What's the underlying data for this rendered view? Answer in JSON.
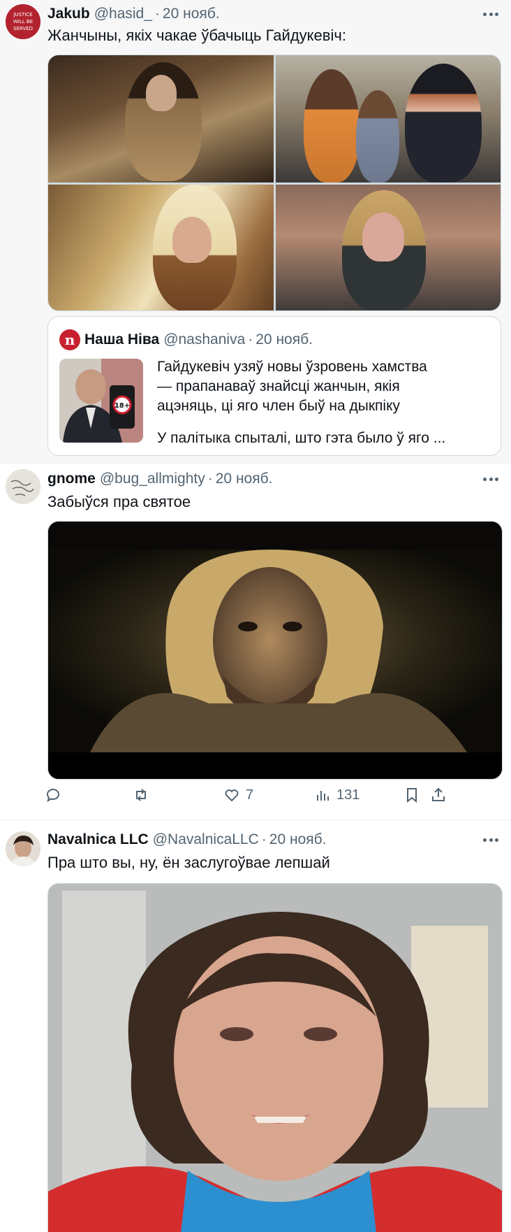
{
  "tweets": [
    {
      "name": "Jakub",
      "handle": "@hasid_",
      "dot": "·",
      "date": "20 нояб.",
      "text": "Жанчыны, якіх чакае ўбачыць Гайдукевіч:",
      "avatar_text": [
        "JUSTICE",
        "WILL BE",
        "SERVED"
      ],
      "quote": {
        "logo_letter": "n",
        "name": "Наша Ніва",
        "handle": "@nashaniva",
        "dot": "·",
        "date": "20 нояб.",
        "lines": [
          "Гайдукевіч узяў новы ўзровень хамства",
          "— прапанаваў знайсці жанчын, якія",
          "ацэняць, ці яго член быў на дыкпіку"
        ],
        "preview": "У палітыка спыталі, што гэта было ў яго ...",
        "thumb_badge": "18+"
      }
    },
    {
      "name": "gnome",
      "handle": "@bug_allmighty",
      "dot": "·",
      "date": "20 нояб.",
      "text": "Забыўся пра святое",
      "actions": {
        "reply_count": "",
        "retweet_count": "",
        "like_count": "7",
        "views_count": "131"
      }
    },
    {
      "name": "Navalnica LLC",
      "handle": "@NavalnicaLLC",
      "dot": "·",
      "date": "20 нояб.",
      "text": "Пра што вы, ну, ён заслугоўвае лепшай"
    }
  ],
  "colors": {
    "text_primary": "#0f1419",
    "text_secondary": "#536471",
    "border": "#cfd9de",
    "nasha_niva_red": "#c8202f"
  }
}
